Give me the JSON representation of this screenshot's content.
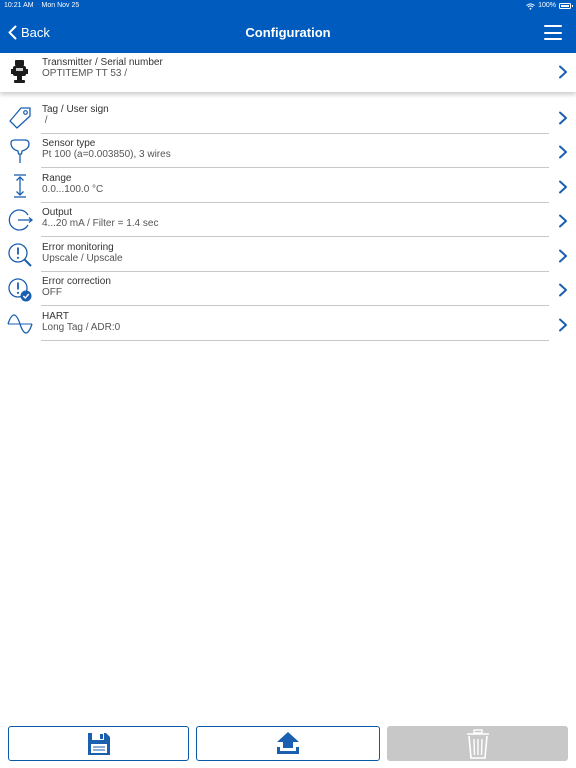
{
  "status_bar": {
    "time": "10:21 AM",
    "date": "Mon Nov 25",
    "battery": "100%"
  },
  "nav": {
    "back_label": "Back",
    "title": "Configuration"
  },
  "transmitter": {
    "title": "Transmitter / Serial number",
    "value": "OPTITEMP TT 53 /"
  },
  "rows": [
    {
      "title": "Tag / User sign",
      "value": " /",
      "icon": "tag-icon"
    },
    {
      "title": "Sensor type",
      "value": "Pt 100 (a=0.003850), 3 wires",
      "icon": "sensor-probe-icon"
    },
    {
      "title": "Range",
      "value": "0.0...100.0 °C",
      "icon": "range-arrows-icon"
    },
    {
      "title": "Output",
      "value": "4...20 mA / Filter = 1.4 sec",
      "icon": "output-icon"
    },
    {
      "title": "Error monitoring",
      "value": "Upscale / Upscale",
      "icon": "error-monitoring-icon"
    },
    {
      "title": "Error correction",
      "value": "OFF",
      "icon": "error-correction-icon"
    },
    {
      "title": "HART",
      "value": "Long Tag / ADR:0",
      "icon": "hart-wave-icon"
    }
  ],
  "bottom_bar": {
    "save_icon": "floppy-disk-icon",
    "upload_icon": "upload-icon",
    "delete_icon": "trash-icon",
    "delete_enabled": false
  },
  "colors": {
    "brand_blue": "#005bbf",
    "chevron_blue": "#1a5fb0",
    "disabled_gray": "#c8c8c8"
  }
}
